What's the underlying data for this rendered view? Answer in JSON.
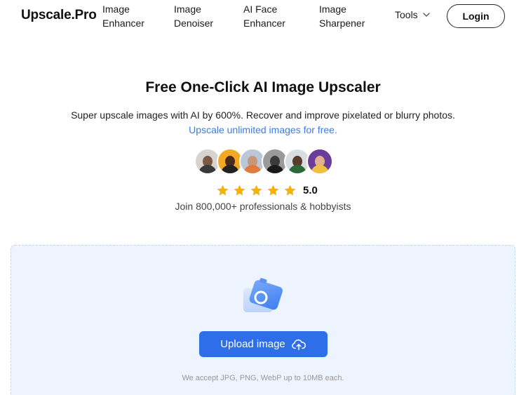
{
  "header": {
    "logo": "Upscale.Pro",
    "nav": [
      {
        "line1": "Image",
        "line2": "Enhancer"
      },
      {
        "line1": "Image",
        "line2": "Denoiser"
      },
      {
        "line1": "AI Face",
        "line2": "Enhancer"
      },
      {
        "line1": "Image",
        "line2": "Sharpener"
      }
    ],
    "tools_label": "Tools",
    "login_label": "Login"
  },
  "hero": {
    "title": "Free One-Click AI Image Upscaler",
    "subtitle": "Super upscale images with AI by 600%. Recover and improve pixelated or blurry photos.",
    "link": "Upscale unlimited images for free.",
    "rating": "5.0",
    "stars": 5,
    "join_text": "Join 800,000+ professionals & hobbyists"
  },
  "upload": {
    "button_label": "Upload image",
    "accept_text": "We accept JPG, PNG, WebP up to 10MB each."
  },
  "colors": {
    "accent": "#2e6ee8",
    "link": "#3b7bea",
    "star": "#f5b301",
    "upload_bg": "#eef4fd"
  }
}
